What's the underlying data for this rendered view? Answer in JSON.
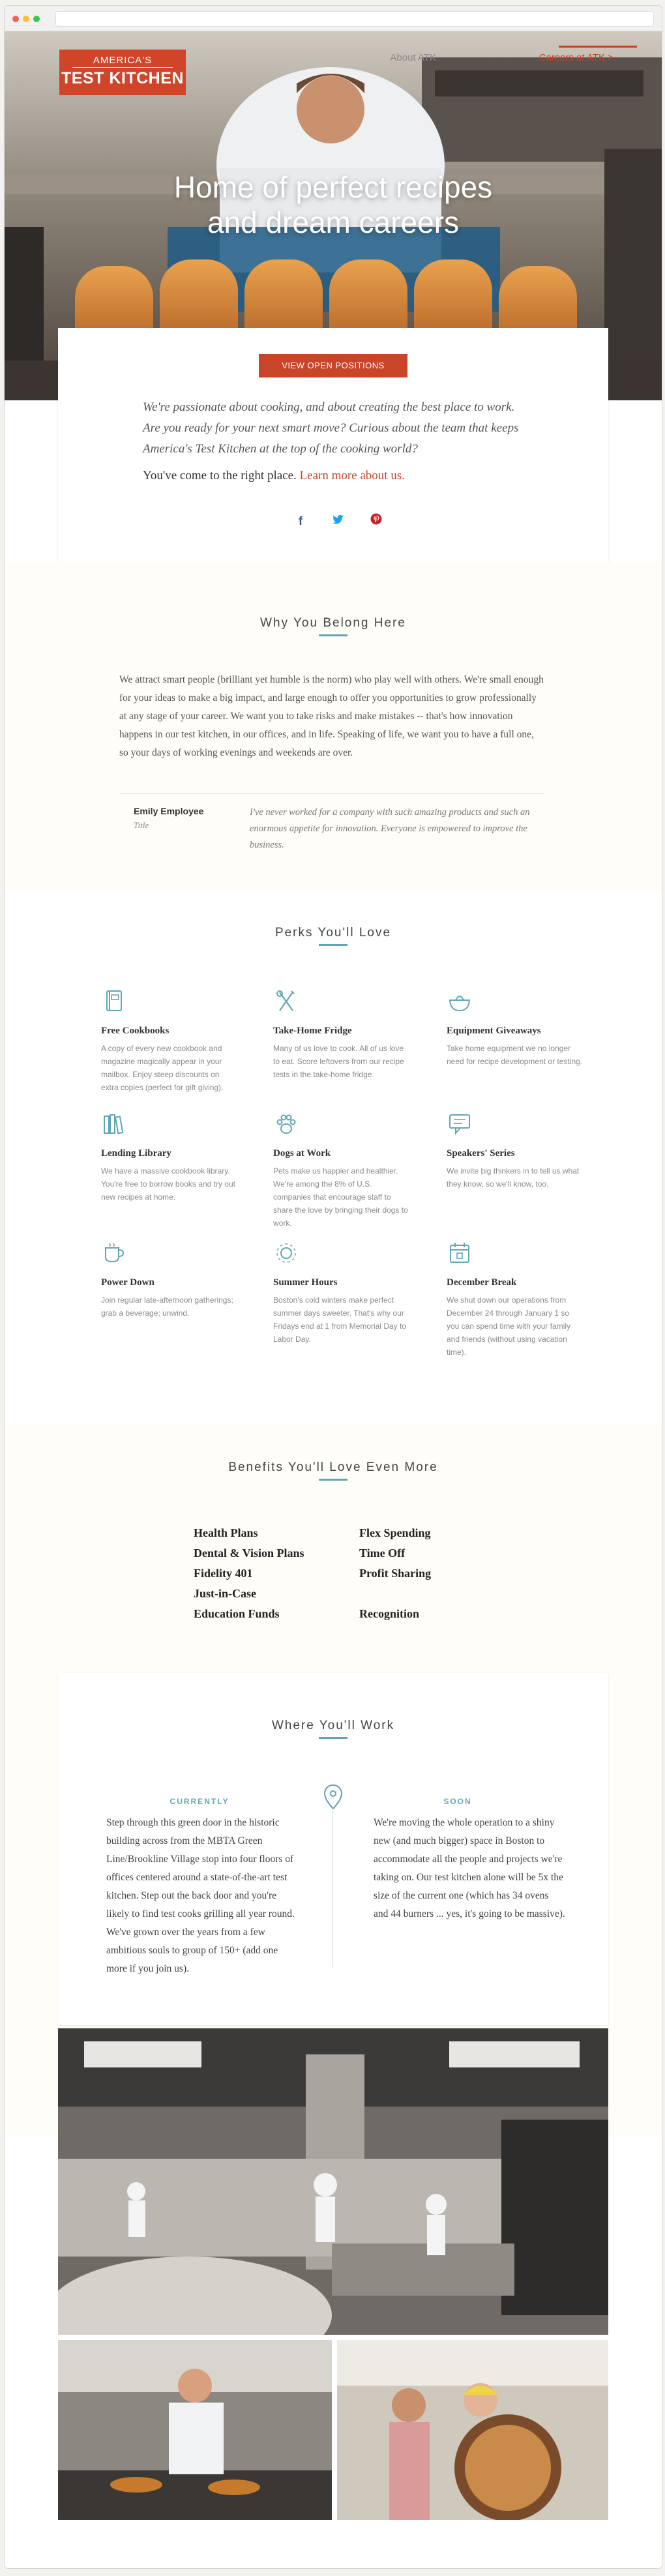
{
  "header": {
    "logo_line1": "AMERICA'S",
    "logo_line2": "TEST KITCHEN",
    "nav": [
      {
        "label": "About ATK",
        "active": false
      },
      {
        "label": "Careers at ATK >",
        "active": true
      }
    ]
  },
  "hero": {
    "title_line1": "Home of perfect recipes",
    "title_line2": "and dream careers"
  },
  "intro": {
    "cta_label": "VIEW OPEN POSITIONS",
    "text": "We're passionate about cooking, and about creating the best place to work. Are you ready for your next smart move? Curious about the team that keeps America's Test Kitchen at the top of the cooking world?",
    "sub_text": "You've come to the right place.",
    "sub_link": "Learn more about us.",
    "share": [
      {
        "icon": "facebook-icon",
        "glyph": "f",
        "color": "#3b5998"
      },
      {
        "icon": "twitter-icon",
        "glyph": "t",
        "color": "#1da1f2"
      },
      {
        "icon": "pinterest-icon",
        "glyph": "p",
        "color": "#cb2027"
      }
    ]
  },
  "belong": {
    "title": "Why You Belong Here",
    "body": "We attract smart people (brilliant yet humble is the norm) who play well with others. We're small enough for your ideas to make a big impact, and large enough to offer you opportunities to grow professionally at any stage of your career. We want you to take risks and make mistakes -- that's how innovation happens in our test kitchen, in our offices, and in life. Speaking of life, we want you to have a full one, so your days of working evenings and weekends are over.",
    "employee_name": "Emily Employee",
    "employee_title": "Title",
    "quote": "I've never worked for a company with such amazing products and such an enormous appetite for innovation. Everyone is empowered to improve the business."
  },
  "perks": {
    "title": "Perks You'll Love",
    "items": [
      {
        "icon": "book-icon",
        "title": "Free Cookbooks",
        "desc": "A copy of every new cookbook and magazine magically appear in your mailbox. Enjoy steep discounts on extra copies (perfect for gift giving)."
      },
      {
        "icon": "utensils-icon",
        "title": "Take-Home Fridge",
        "desc": "Many of us love to cook. All of us love to eat. Score leftovers from our recipe tests in the take-home fridge."
      },
      {
        "icon": "mixing-bowl-icon",
        "title": "Equipment Giveaways",
        "desc": "Take home equipment we no longer need for recipe development or testing."
      },
      {
        "icon": "library-books-icon",
        "title": "Lending Library",
        "desc": "We have a massive cookbook library. You're free to borrow books and try out new recipes at home."
      },
      {
        "icon": "paw-icon",
        "title": "Dogs at Work",
        "desc": "Pets make us happier and healthier. We're among the 8% of U.S. companies that encourage staff to share the love by bringing their dogs to work."
      },
      {
        "icon": "speech-bubble-icon",
        "title": "Speakers' Series",
        "desc": "We invite big thinkers in to tell us what they know, so we'll know, too."
      },
      {
        "icon": "coffee-cup-icon",
        "title": "Power Down",
        "desc": "Join regular late-afternoon gatherings; grab a beverage; unwind."
      },
      {
        "icon": "sun-icon",
        "title": "Summer Hours",
        "desc": "Boston's cold winters make perfect summer days sweeter. That's why our Fridays end at 1 from Memorial Day to Labor Day."
      },
      {
        "icon": "calendar-icon",
        "title": "December Break",
        "desc": "We shut down our operations from December 24 through January 1 so you can spend time with your family and friends (without using vacation time)."
      }
    ]
  },
  "benefits": {
    "title": "Benefits You'll Love Even More",
    "col1": [
      "Health Plans",
      "Dental & Vision Plans",
      "Fidelity 401",
      "Just-in-Case",
      "Education Funds"
    ],
    "col2": [
      "Flex Spending",
      "Time Off",
      "Profit Sharing",
      "",
      "Recognition"
    ]
  },
  "work": {
    "title": "Where You'll Work",
    "left_label": "CURRENTLY",
    "left_text": "Step through this green door in the historic building across from the MBTA Green Line/Brookline Village stop into four floors of offices centered around a state-of-the-art test kitchen. Step out the back door and you're likely to find test cooks grilling all year round. We've grown over the years from a few ambitious souls to group of 150+ (add one more if you join us).",
    "right_label": "SOON",
    "right_text": "We're moving the whole operation to a shiny new (and much bigger) space in Boston to accommodate all the people and projects we're taking on. Our test kitchen alone will be 5x the size of the current one (which has 34 ovens and 44 burners ... yes, it's going to be massive)."
  },
  "colors": {
    "brand_red": "#c9452a",
    "accent_teal": "#5fa6b5"
  }
}
